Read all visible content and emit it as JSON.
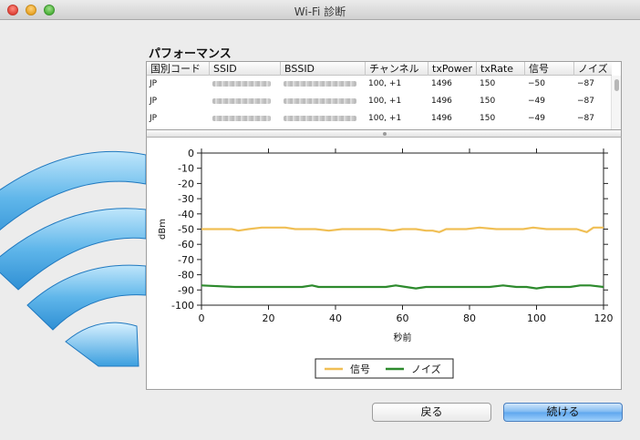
{
  "window": {
    "title": "Wi-Fi 診断"
  },
  "section": {
    "title": "パフォーマンス"
  },
  "table": {
    "columns": [
      "国別コード",
      "SSID",
      "BSSID",
      "チャンネル",
      "txPower",
      "txRate",
      "信号",
      "ノイズ"
    ],
    "rows": [
      {
        "country": "JP",
        "channel": "100, +1",
        "txpower": "1496",
        "txrate": "150",
        "signal": "−50",
        "noise": "−87"
      },
      {
        "country": "JP",
        "channel": "100, +1",
        "txpower": "1496",
        "txrate": "150",
        "signal": "−49",
        "noise": "−87"
      },
      {
        "country": "JP",
        "channel": "100, +1",
        "txpower": "1496",
        "txrate": "150",
        "signal": "−49",
        "noise": "−87"
      }
    ]
  },
  "chart_data": {
    "type": "line",
    "xlabel": "秒前",
    "ylabel": "dBm",
    "xlim": [
      0,
      120
    ],
    "ylim": [
      -100,
      0
    ],
    "x_ticks": [
      0,
      20,
      40,
      60,
      80,
      100,
      120
    ],
    "y_ticks": [
      0,
      -10,
      -20,
      -30,
      -40,
      -50,
      -60,
      -70,
      -80,
      -90,
      -100
    ],
    "legend_position": "bottom-center",
    "series": [
      {
        "name": "信号",
        "color": "#f0bf55",
        "x": [
          0,
          5,
          9,
          11,
          14,
          18,
          22,
          25,
          28,
          31,
          34,
          38,
          42,
          47,
          50,
          53,
          57,
          60,
          64,
          67,
          69,
          71,
          73,
          75,
          79,
          83,
          88,
          93,
          96,
          99,
          103,
          108,
          112,
          115,
          117,
          119,
          120
        ],
        "y": [
          -50,
          -50,
          -50,
          -51,
          -50,
          -49,
          -49,
          -49,
          -50,
          -50,
          -50,
          -51,
          -50,
          -50,
          -50,
          -50,
          -51,
          -50,
          -50,
          -51,
          -51,
          -52,
          -50,
          -50,
          -50,
          -49,
          -50,
          -50,
          -50,
          -49,
          -50,
          -50,
          -50,
          -52,
          -49,
          -49,
          -49
        ]
      },
      {
        "name": "ノイズ",
        "color": "#2d8a2d",
        "x": [
          0,
          10,
          30,
          33,
          35,
          40,
          45,
          55,
          58,
          61,
          64,
          67,
          70,
          80,
          86,
          90,
          94,
          97,
          100,
          103,
          106,
          110,
          113,
          116,
          120
        ],
        "y": [
          -87,
          -88,
          -88,
          -87,
          -88,
          -88,
          -88,
          -88,
          -87,
          -88,
          -89,
          -88,
          -88,
          -88,
          -88,
          -87,
          -88,
          -88,
          -89,
          -88,
          -88,
          -88,
          -87,
          -87,
          -88
        ]
      }
    ]
  },
  "buttons": {
    "back": "戻る",
    "continue": "続ける"
  }
}
